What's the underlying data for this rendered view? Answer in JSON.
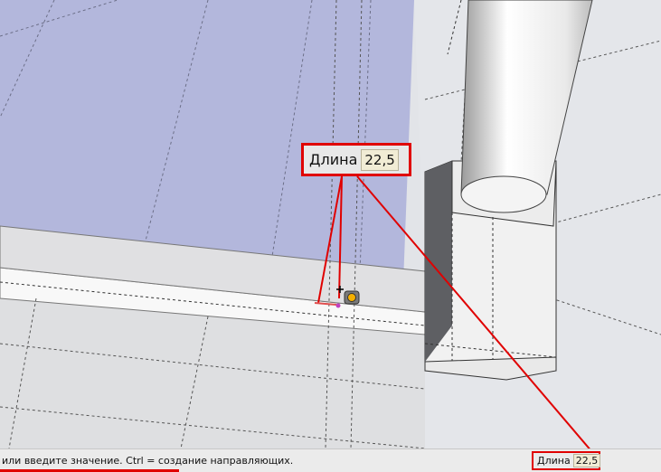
{
  "tooltip": {
    "label": "Длина",
    "value": "22,5"
  },
  "statusbar": {
    "hint": "или введите значение.  Ctrl = создание направляющих.",
    "vcb_label": "Длина",
    "vcb_value": "22,5"
  },
  "icons": {
    "cursor": "tape-measure-icon"
  },
  "colors": {
    "highlight": "#e00000",
    "face_blue": "#b3b7dc",
    "value_box": "#f1ecd5"
  }
}
